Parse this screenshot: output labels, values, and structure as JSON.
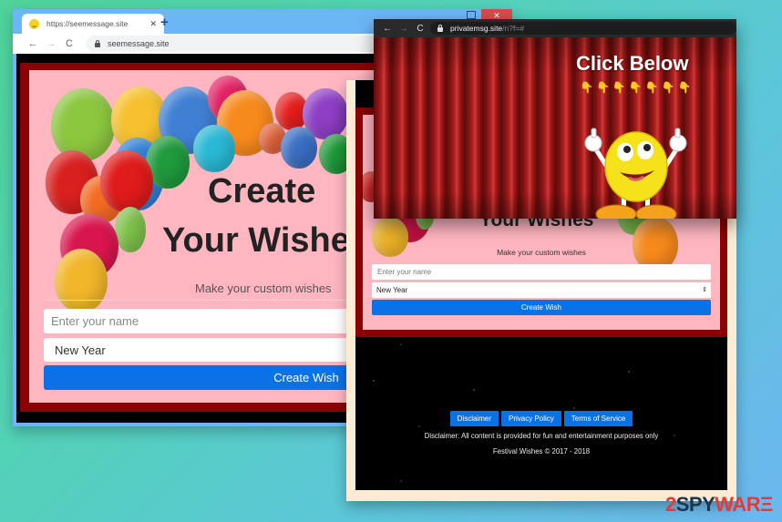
{
  "window_left": {
    "tab": {
      "favicon": "smiley-face-icon",
      "title": "https://seemessage.site",
      "close": "✕"
    },
    "new_tab": "+",
    "controls": {
      "maximize": "maximize-icon",
      "close": "✕"
    },
    "nav": {
      "back": "←",
      "forward": "→",
      "reload": "C"
    },
    "url": "seemessage.site",
    "page": {
      "heading_line1": "Create",
      "heading_line2": "Your Wishes",
      "subtitle": "Make your custom wishes",
      "name_placeholder": "Enter your name",
      "occasion_selected": "New Year",
      "submit_label": "Create Wish"
    }
  },
  "window_popup": {
    "nav": {
      "back": "←",
      "forward": "→",
      "reload": "C"
    },
    "url_host": "privatemsg.site",
    "url_path": "/n?f=#",
    "heading": "Click Below",
    "pointing_hands": [
      "👇",
      "👇",
      "👇",
      "👇",
      "👇",
      "👇",
      "👇"
    ],
    "mascot": "thumbs-up-smiley"
  },
  "window_middle": {
    "page": {
      "heading": "Your Wishes",
      "subtitle": "Make your custom wishes",
      "name_placeholder": "Enter your name",
      "occasion_selected": "New Year",
      "select_arrows": "⇕",
      "submit_label": "Create Wish",
      "footer_links": [
        "Disclaimer",
        "Privacy Policy",
        "Terms of Service"
      ],
      "disclaimer": "Disclaimer: All content is provided for fun and entertainment purposes only",
      "copyright": "Festival Wishes © 2017 - 2018"
    }
  },
  "watermark": {
    "part1": "2",
    "part2": "SPY",
    "part3": "WAR",
    "part4": "Ξ"
  },
  "colors": {
    "button_blue": "#0b72e6",
    "page_pink": "#ffb6c1",
    "frame_maroon": "#8b0000",
    "watermark_red": "#e23b3b"
  }
}
